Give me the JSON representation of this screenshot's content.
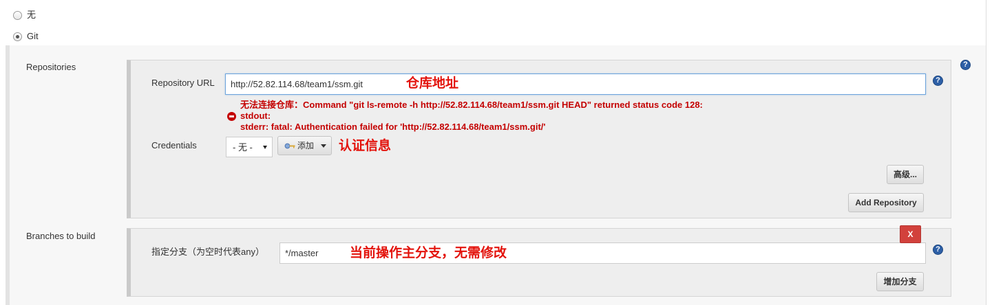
{
  "scm": {
    "options": [
      {
        "label": "无",
        "selected": false
      },
      {
        "label": "Git",
        "selected": true
      }
    ]
  },
  "repositories": {
    "label": "Repositories",
    "url_label": "Repository URL",
    "url_value": "http://52.82.114.68/team1/ssm.git",
    "url_annotation": "仓库地址",
    "error": {
      "line1": "无法连接仓库：Command \"git ls-remote -h http://52.82.114.68/team1/ssm.git HEAD\" returned status code 128:",
      "line2": "stdout:",
      "line3": "stderr: fatal: Authentication failed for 'http://52.82.114.68/team1/ssm.git/'"
    },
    "credentials_label": "Credentials",
    "credentials_value": "- 无 -",
    "add_credentials_label": "添加",
    "credentials_annotation": "认证信息",
    "advanced_label": "高级...",
    "add_repository_label": "Add Repository"
  },
  "branches": {
    "label": "Branches to build",
    "delete_label": "X",
    "specifier_label": "指定分支（为空时代表any）",
    "specifier_value": "*/master",
    "annotation": "当前操作主分支，无需修改",
    "add_branch_label": "增加分支"
  },
  "icons": {
    "help": {
      "name": "help-icon",
      "glyph": "?"
    },
    "error": "error-icon",
    "key": "key-icon",
    "dropdown": "chevron-down-icon"
  },
  "colors": {
    "annotation": "#e3120b",
    "error": "#c40000",
    "focus_border": "#6ea4dc",
    "help_icon": "#2d5fa6",
    "delete_button": "#d2413c"
  }
}
